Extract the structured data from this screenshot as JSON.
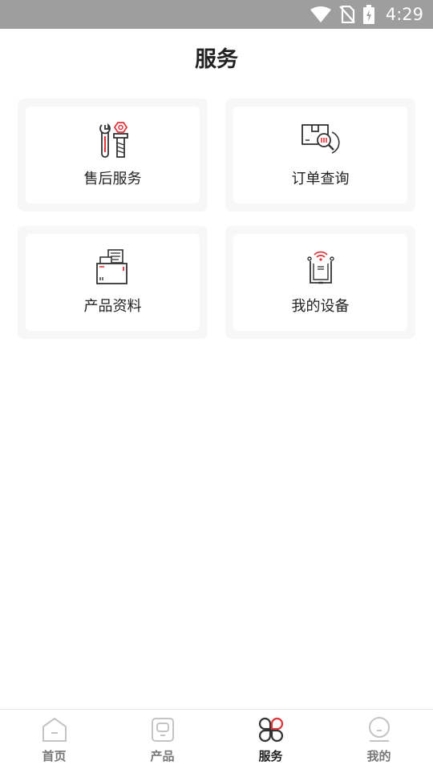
{
  "status_bar": {
    "time": "4:29",
    "icons": [
      "wifi-icon",
      "no-sim-icon",
      "battery-charging-icon"
    ]
  },
  "header": {
    "title": "服务"
  },
  "services": [
    {
      "label": "售后服务",
      "icon": "tools-icon"
    },
    {
      "label": "订单查询",
      "icon": "order-search-icon"
    },
    {
      "label": "产品资料",
      "icon": "product-docs-icon"
    },
    {
      "label": "我的设备",
      "icon": "my-device-icon"
    }
  ],
  "bottom_nav": {
    "items": [
      {
        "label": "首页",
        "icon": "home-icon",
        "active": false
      },
      {
        "label": "产品",
        "icon": "product-icon",
        "active": false
      },
      {
        "label": "服务",
        "icon": "service-icon",
        "active": true
      },
      {
        "label": "我的",
        "icon": "profile-icon",
        "active": false
      }
    ]
  },
  "colors": {
    "accent": "#e0343b",
    "status_bar": "#9e9e9e",
    "icon_stroke": "#333333",
    "inactive": "#bbbbbb"
  }
}
